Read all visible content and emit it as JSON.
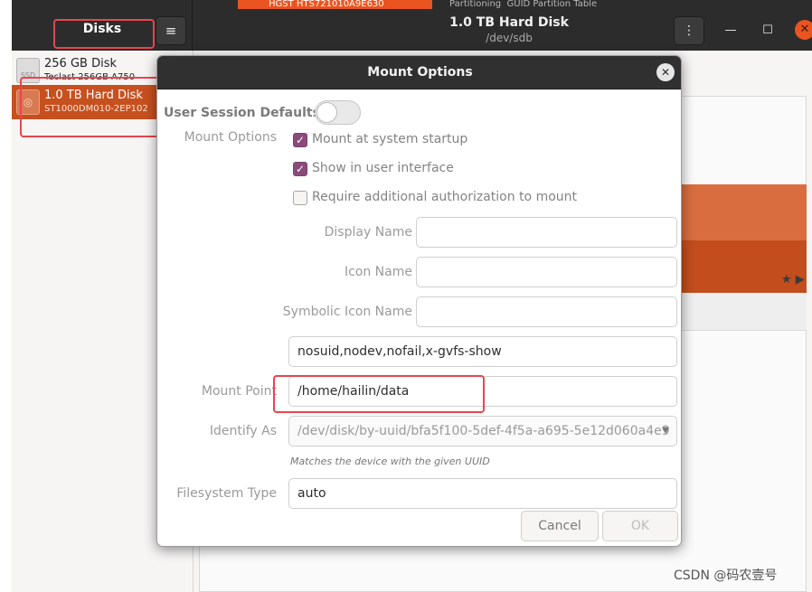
{
  "app": {
    "sidebar_title": "Disks",
    "menu_icon": "≡",
    "device_title": "1.0 TB Hard Disk",
    "device_path": "/dev/sdb",
    "kebab_icon": "⋮",
    "minimize_icon": "—",
    "maximize_icon": "☐",
    "close_icon": "✕",
    "peek_disk": "HGST HTS721010A9E630",
    "peek_partitioning": "Partitioning",
    "peek_partition_table": "GUID Partition Table",
    "volume_controls": "★ ▶"
  },
  "sidebar": {
    "disks": [
      {
        "icon": "SSD",
        "name": "256 GB Disk",
        "model": "Teclast 256GB A750"
      },
      {
        "icon": "◎",
        "name": "1.0 TB Hard Disk",
        "model": "ST1000DM010-2EP102"
      }
    ]
  },
  "dialog": {
    "title": "Mount Options",
    "close_icon": "✕",
    "user_session_defaults_label": "User Session Defaults",
    "mount_options_label": "Mount Options",
    "check_mark": "✓",
    "checkboxes": [
      {
        "label": "Mount at system startup",
        "checked": true
      },
      {
        "label": "Show in user interface",
        "checked": true
      },
      {
        "label": "Require additional authorization to mount",
        "checked": false
      }
    ],
    "display_name_label": "Display Name",
    "display_name_value": "",
    "icon_name_label": "Icon Name",
    "icon_name_value": "",
    "symbolic_icon_name_label": "Symbolic Icon Name",
    "symbolic_icon_name_value": "",
    "options_value": "nosuid,nodev,nofail,x-gvfs-show",
    "mount_point_label": "Mount Point",
    "mount_point_value": "/home/hailin/data",
    "identify_as_label": "Identify As",
    "identify_as_value": "/dev/disk/by-uuid/bfa5f100-5def-4f5a-a695-5e12d060a4e9",
    "identify_as_hint": "Matches the device with the given UUID",
    "filesystem_type_label": "Filesystem Type",
    "filesystem_type_value": "auto",
    "cancel_label": "Cancel",
    "ok_label": "OK",
    "dropdown_icon": "▼"
  },
  "watermark": "CSDN @码农壹号",
  "colors": {
    "accent": "#e95420",
    "selection": "#c7501f",
    "checkbox": "#8a4b7c",
    "annotation": "#e8454f"
  }
}
